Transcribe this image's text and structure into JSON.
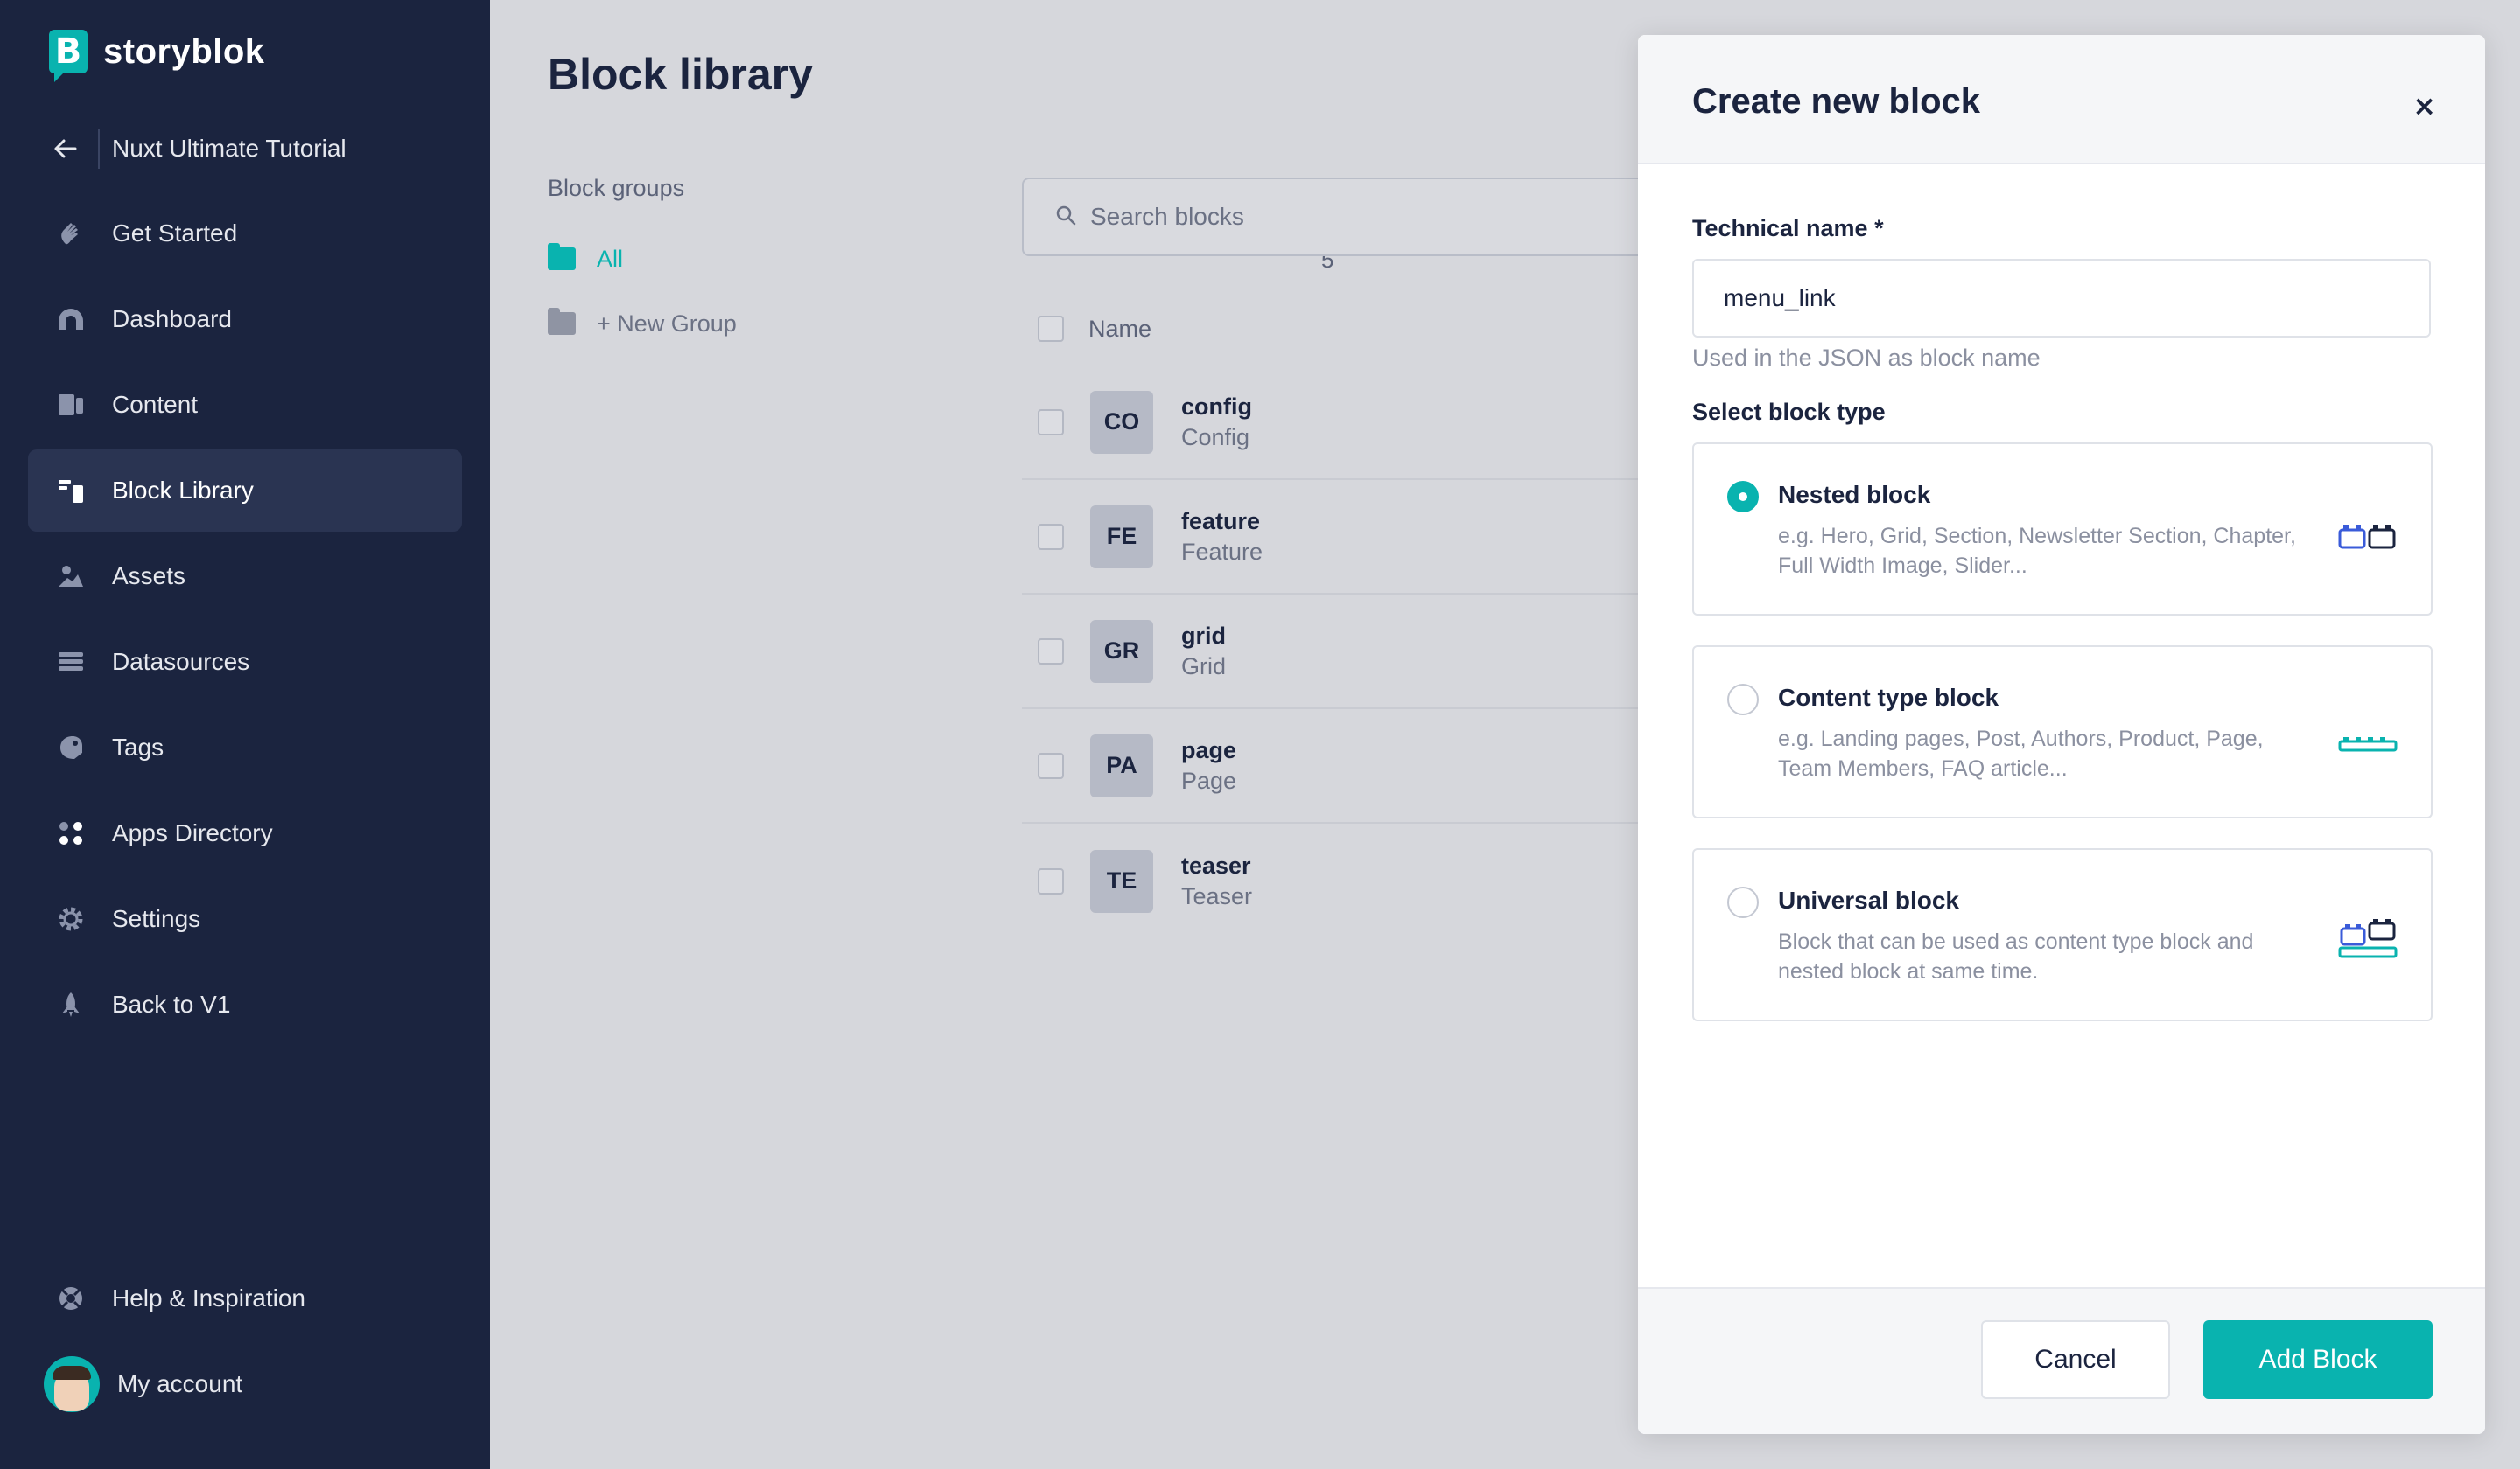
{
  "brand": {
    "name": "storyblok",
    "mark": "B"
  },
  "space": {
    "name": "Nuxt Ultimate Tutorial"
  },
  "nav": {
    "items": [
      {
        "label": "Get Started",
        "icon": "wave-hand-icon"
      },
      {
        "label": "Dashboard",
        "icon": "dashboard-gauge-icon"
      },
      {
        "label": "Content",
        "icon": "content-icon"
      },
      {
        "label": "Block Library",
        "icon": "blocks-icon",
        "active": true
      },
      {
        "label": "Assets",
        "icon": "image-icon"
      },
      {
        "label": "Datasources",
        "icon": "datasources-icon"
      },
      {
        "label": "Tags",
        "icon": "tag-icon"
      },
      {
        "label": "Apps Directory",
        "icon": "apps-icon"
      },
      {
        "label": "Settings",
        "icon": "gear-icon"
      },
      {
        "label": "Back to V1",
        "icon": "rocket-icon"
      }
    ],
    "help": "Help & Inspiration",
    "account": "My account"
  },
  "main": {
    "title": "Block library",
    "groups_label": "Block groups",
    "groups": [
      {
        "label": "All",
        "count": "5",
        "active": true
      },
      {
        "label": "+ New Group"
      }
    ],
    "search_placeholder": "Search blocks",
    "table_header": "Name",
    "rows": [
      {
        "badge": "CO",
        "name": "config",
        "display": "Config"
      },
      {
        "badge": "FE",
        "name": "feature",
        "display": "Feature"
      },
      {
        "badge": "GR",
        "name": "grid",
        "display": "Grid"
      },
      {
        "badge": "PA",
        "name": "page",
        "display": "Page"
      },
      {
        "badge": "TE",
        "name": "teaser",
        "display": "Teaser"
      }
    ]
  },
  "modal": {
    "title": "Create new block",
    "close": "×",
    "technical_label": "Technical name *",
    "technical_value": "menu_link",
    "technical_help": "Used in the JSON as block name",
    "type_label": "Select block type",
    "types": [
      {
        "title": "Nested block",
        "desc": "e.g. Hero, Grid, Section, Newsletter Section, Chapter, Full Width Image, Slider...",
        "selected": true,
        "icon": "nested-block-icon"
      },
      {
        "title": "Content type block",
        "desc": "e.g. Landing pages, Post, Authors, Product, Page, Team Members, FAQ article...",
        "selected": false,
        "icon": "content-type-block-icon"
      },
      {
        "title": "Universal block",
        "desc": "Block that can be used as content type block and nested block at same time.",
        "selected": false,
        "icon": "universal-block-icon"
      }
    ],
    "cancel": "Cancel",
    "submit": "Add Block"
  },
  "colors": {
    "sidebar": "#1b243f",
    "accent": "#09b3af",
    "overlay": "#d6d7dc",
    "nav_active": "#2a3452"
  }
}
